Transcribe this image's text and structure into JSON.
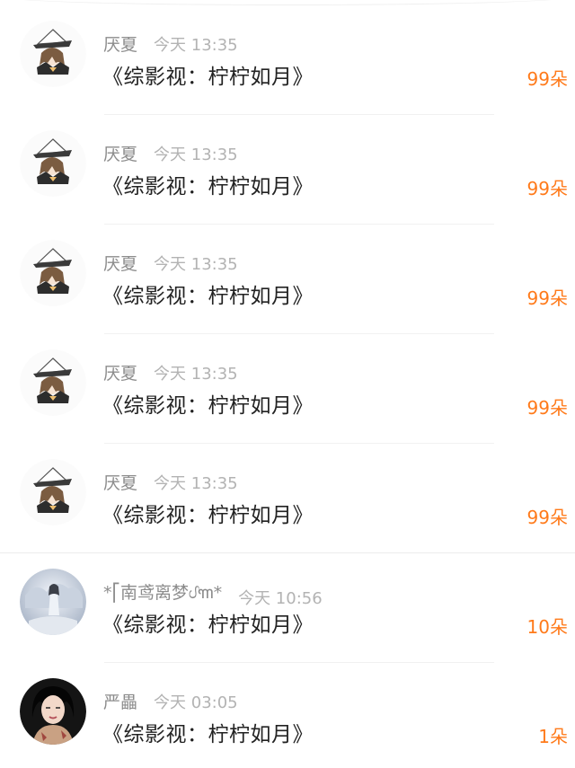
{
  "colors": {
    "name": "#8c8c8c",
    "time": "#b3b3b3",
    "title": "#222222",
    "count": "#ff7a1a"
  },
  "gifts": [
    {
      "avatar": "anime-character-avatar",
      "user": "厌夏",
      "time": "今天 13:35",
      "title": "《综影视：柠柠如月》",
      "count": "99朵"
    },
    {
      "avatar": "anime-character-avatar",
      "user": "厌夏",
      "time": "今天 13:35",
      "title": "《综影视：柠柠如月》",
      "count": "99朵"
    },
    {
      "avatar": "anime-character-avatar",
      "user": "厌夏",
      "time": "今天 13:35",
      "title": "《综影视：柠柠如月》",
      "count": "99朵"
    },
    {
      "avatar": "anime-character-avatar",
      "user": "厌夏",
      "time": "今天 13:35",
      "title": "《综影视：柠柠如月》",
      "count": "99朵"
    },
    {
      "avatar": "anime-character-avatar",
      "user": "厌夏",
      "time": "今天 13:35",
      "title": "《综影视：柠柠如月》",
      "count": "99朵"
    },
    {
      "avatar": "snow-scene-avatar",
      "user": "*⎡南鸢离梦ᦔ꧑*",
      "time": "今天 10:56",
      "title": "《综影视：柠柠如月》",
      "count": "10朵"
    },
    {
      "avatar": "portrait-photo-avatar",
      "user": "严畾",
      "time": "今天 03:05",
      "title": "《综影视：柠柠如月》",
      "count": "1朵"
    }
  ]
}
